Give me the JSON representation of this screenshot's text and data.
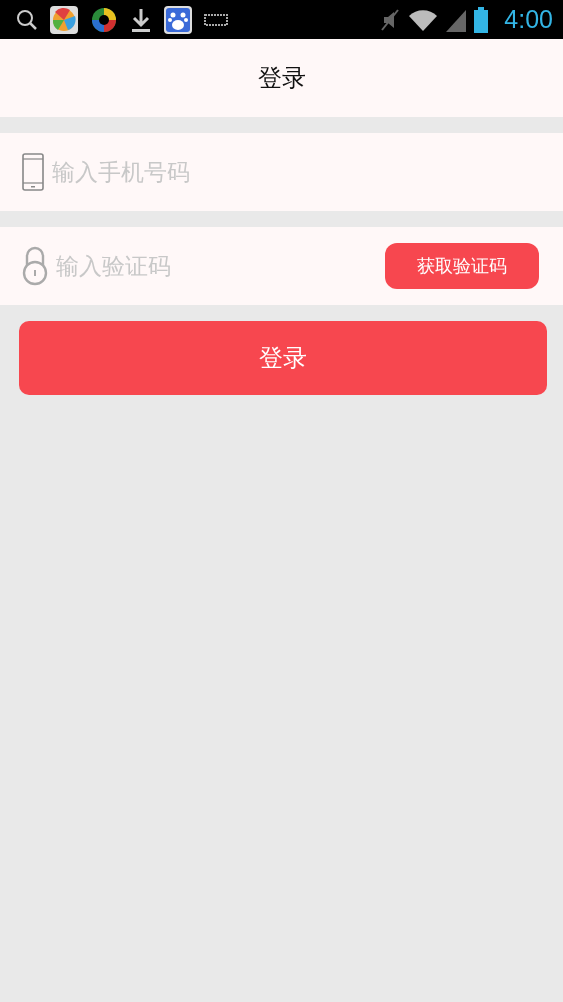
{
  "status_bar": {
    "time": "4:00"
  },
  "header": {
    "title": "登录"
  },
  "fields": [
    {
      "kind": "phone",
      "placeholder": "输入手机号码"
    },
    {
      "kind": "code",
      "placeholder": "输入验证码",
      "button": "获取验证码"
    }
  ],
  "login_button": "登录"
}
